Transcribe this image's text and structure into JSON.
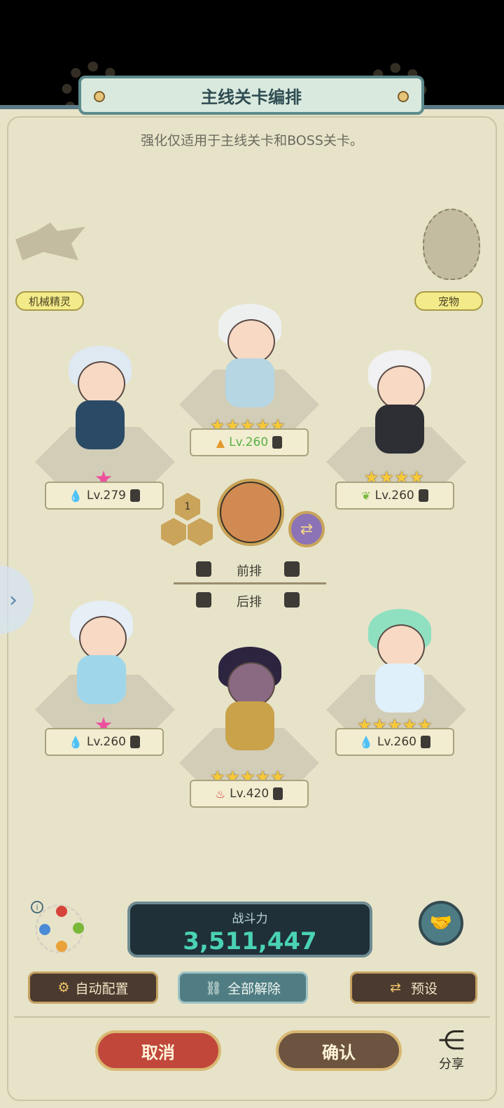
{
  "header": {
    "title": "主线关卡编排",
    "subtitle": "强化仅适用于主线关卡和BOSS关卡。"
  },
  "slots": {
    "mech_label": "机械精灵",
    "pet_label": "宠物"
  },
  "heroes": [
    {
      "level": "Lv.279",
      "element": "water-icon",
      "role": "sword-icon",
      "stars": "",
      "pink_star": true
    },
    {
      "level": "Lv.260",
      "element": "earth-icon",
      "role": "shield-icon",
      "stars": "★★★★★",
      "pink_star": false
    },
    {
      "level": "Lv.260",
      "element": "wind-icon",
      "role": "shield-icon",
      "stars": "★★★★",
      "pink_star": false
    },
    {
      "level": "Lv.260",
      "element": "water-icon",
      "role": "cross-icon",
      "stars": "",
      "pink_star": true
    },
    {
      "level": "Lv.420",
      "element": "fire-icon",
      "role": "bow-icon",
      "stars": "★★★★★",
      "pink_star": false
    },
    {
      "level": "Lv.260",
      "element": "water-icon",
      "role": "bow-icon",
      "stars": "★★★★★",
      "pink_star": false
    }
  ],
  "leader": {
    "badge": "1"
  },
  "rows": {
    "front": "前排",
    "back": "后排"
  },
  "power": {
    "label": "战斗力",
    "value": "3,511,447"
  },
  "buttons": {
    "auto": "自动配置",
    "clear": "全部解除",
    "preset": "预设",
    "cancel": "取消",
    "confirm": "确认",
    "share": "分享"
  },
  "colors": {
    "panel": "#e7e3c9",
    "accent_teal": "#4ad2b4",
    "cancel_red": "#c0473a",
    "confirm_brown": "#6d5440"
  }
}
